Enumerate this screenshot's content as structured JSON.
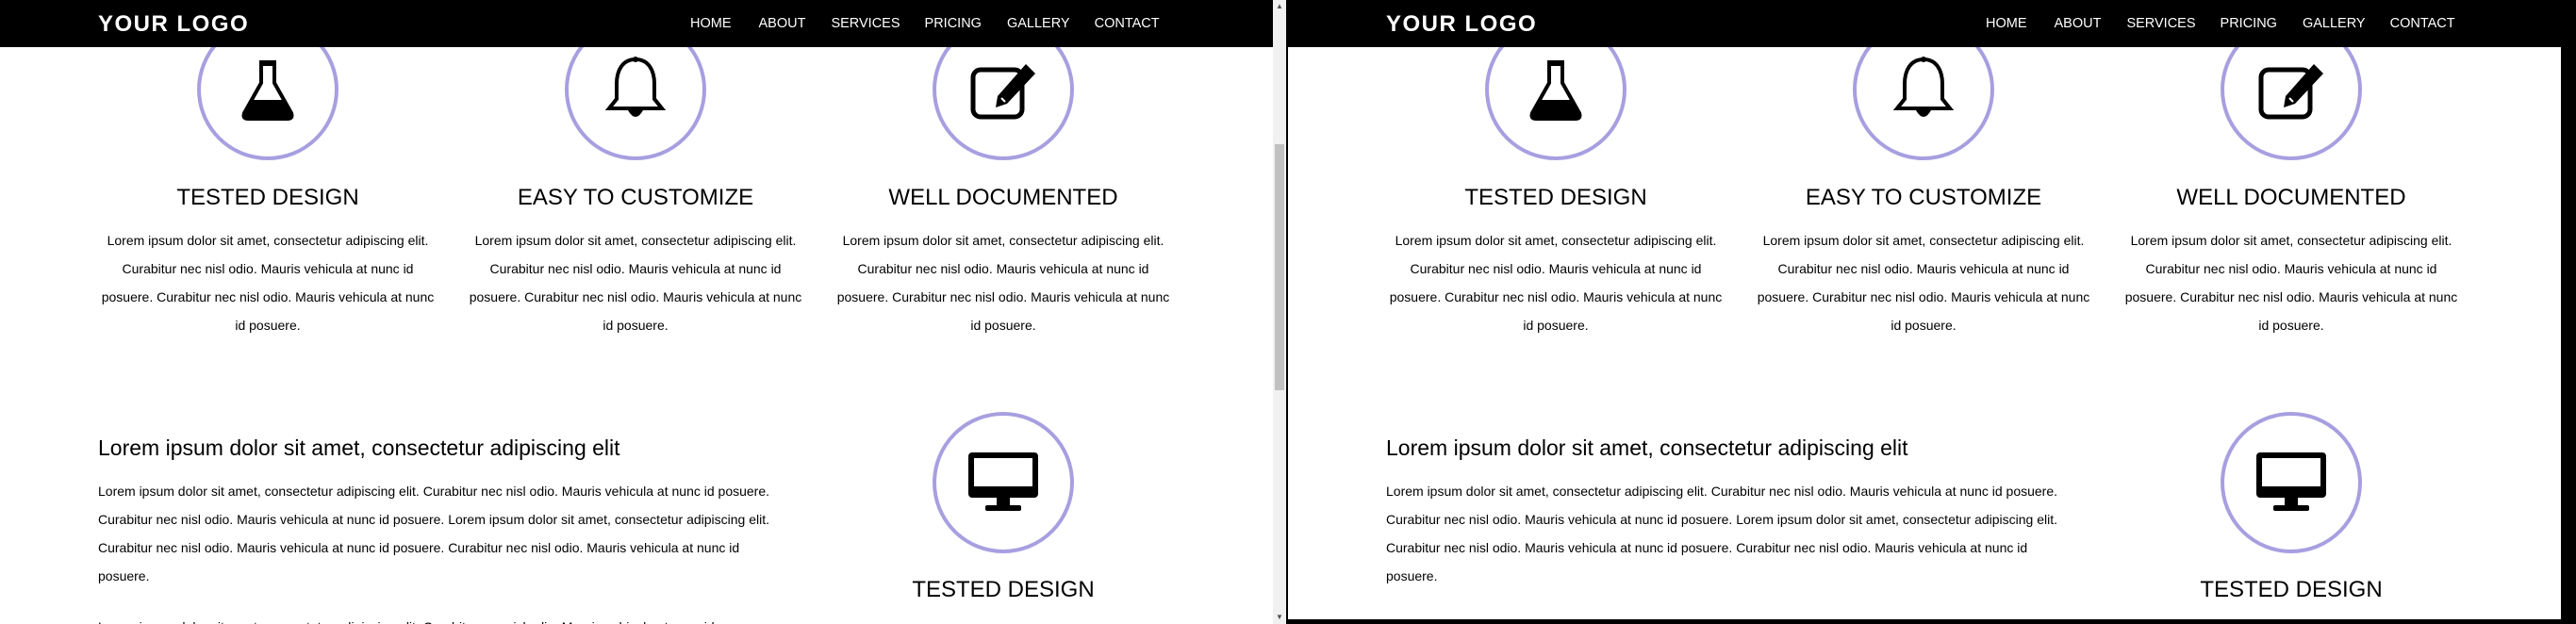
{
  "brand": {
    "logo_text": "YOUR LOGO"
  },
  "nav": [
    "HOME",
    "ABOUT",
    "SERVICES",
    "PRICING",
    "GALLERY",
    "CONTACT"
  ],
  "features": [
    {
      "icon": "flask-icon",
      "title": "TESTED DESIGN",
      "lines": [
        "Lorem ipsum dolor sit amet, consectetur adipiscing elit.",
        "Curabitur nec nisl odio. Mauris vehicula at nunc id",
        "posuere. Curabitur nec nisl odio. Mauris vehicula at nunc",
        "id posuere."
      ]
    },
    {
      "icon": "bell-icon",
      "title": "EASY TO CUSTOMIZE",
      "lines": [
        "Lorem ipsum dolor sit amet, consectetur adipiscing elit.",
        "Curabitur nec nisl odio. Mauris vehicula at nunc id",
        "posuere. Curabitur nec nisl odio. Mauris vehicula at nunc",
        "id posuere."
      ]
    },
    {
      "icon": "edit-icon",
      "title": "WELL DOCUMENTED",
      "lines": [
        "Lorem ipsum dolor sit amet, consectetur adipiscing elit.",
        "Curabitur nec nisl odio. Mauris vehicula at nunc id",
        "posuere. Curabitur nec nisl odio. Mauris vehicula at nunc",
        "id posuere."
      ]
    }
  ],
  "section": {
    "heading": "Lorem ipsum dolor sit amet, consectetur adipiscing elit",
    "lines": [
      "Lorem ipsum dolor sit amet, consectetur adipiscing elit. Curabitur nec nisl odio. Mauris vehicula at nunc id posuere.",
      "Curabitur nec nisl odio. Mauris vehicula at nunc id posuere. Lorem ipsum dolor sit amet, consectetur adipiscing elit.",
      "Curabitur nec nisl odio. Mauris vehicula at nunc id posuere. Curabitur nec nisl odio. Mauris vehicula at nunc id",
      "posuere."
    ],
    "cut_line": "Lorem ipsum dolor sit amet, consectetur adipiscing elit. Curabitur nec nisl odio. Mauris vehicula at nunc id posuere.",
    "icon": "monitor-icon",
    "icon_title": "TESTED DESIGN"
  },
  "colors": {
    "navbar": "#000000",
    "circle_border": "#a79fe0",
    "scrollbar_thumb": "#c1c1c1"
  }
}
